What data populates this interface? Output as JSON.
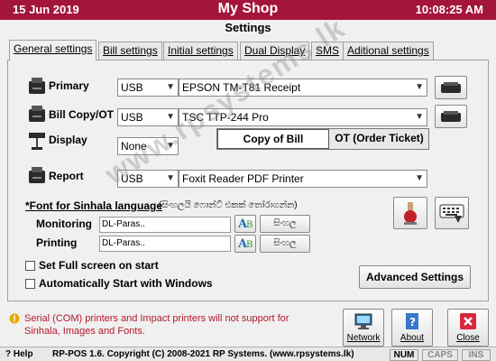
{
  "title_bar": {
    "date": "15 Jun 2019",
    "app_name": "My Shop",
    "time": "10:08:25 AM",
    "color": "#a3153a"
  },
  "window_title": "Settings",
  "tabs": [
    "General settings",
    "Bill settings",
    "Initial settings",
    "Dual Display",
    "SMS",
    "Aditional settings"
  ],
  "printers": {
    "primary": {
      "label": "Primary",
      "port": "USB",
      "printer": "EPSON TM-T81 Receipt"
    },
    "bill_copy": {
      "label": "Bill Copy/OT",
      "port": "USB",
      "printer": "TSC TTP-244 Pro"
    },
    "display": {
      "label": "Display",
      "port": "None"
    },
    "report": {
      "label": "Report",
      "port": "USB",
      "printer": "Foxit Reader PDF Printer"
    }
  },
  "bill_toggle": {
    "copy_of_bill": "Copy of Bill",
    "ot": "OT (Order Ticket)"
  },
  "sinhala_font": {
    "heading": "*Font for Sinhala language",
    "heading_sinhala": "(සිංහලයි ෆොන්ට් එකක් තෝරාගන්න)",
    "monitoring_label": "Monitoring",
    "monitoring_value": "DL-Paras..",
    "printing_label": "Printing",
    "printing_value": "DL-Paras..",
    "sample_text": "සිංහල"
  },
  "options": {
    "full_screen": "Set Full screen on start",
    "auto_start": "Automatically Start with Windows"
  },
  "advanced_button": "Advanced Settings",
  "warning": "Serial (COM) printers and Impact printers will not support for Sinhala, Images and Fonts.",
  "bottom_buttons": {
    "network": "Network",
    "about": "About",
    "close": "Close"
  },
  "status_bar": {
    "help_key": "? Help",
    "copyright": "RP-POS 1.6. Copyright (C) 2008-2021 RP Systems. (www.rpsystems.lk)",
    "num": "NUM",
    "caps": "CAPS",
    "ins": "INS"
  },
  "watermark": "www.rpsystems.lk"
}
